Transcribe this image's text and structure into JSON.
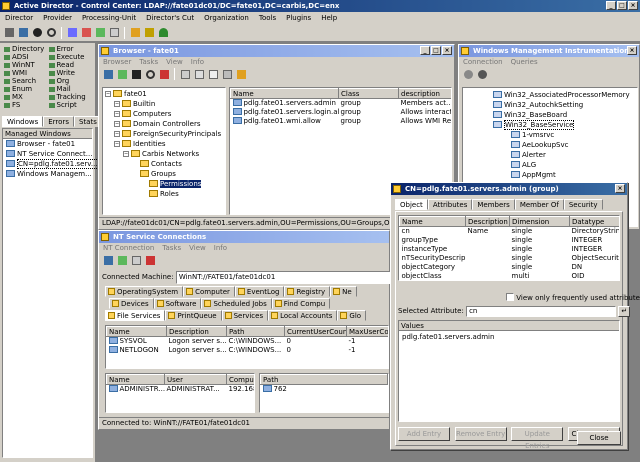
{
  "app": {
    "title": "Active Director - Control Center: LDAP://fate01dc01/DC=fate01,DC=carbis,DC=enx",
    "menu": [
      "Director",
      "Provider",
      "Processing-Unit",
      "Director's Cut",
      "Organization",
      "Tools",
      "Plugins",
      "Help"
    ]
  },
  "left_panel": {
    "buttons": [
      {
        "label": "Directory",
        "color": "#4a8a4a"
      },
      {
        "label": "Error",
        "color": "#4a8a4a"
      },
      {
        "label": "ADSI",
        "color": "#4a8a4a"
      },
      {
        "label": "Execute",
        "color": "#4a8a4a"
      },
      {
        "label": "WinNT",
        "color": "#4a8a4a"
      },
      {
        "label": "Read",
        "color": "#4a8a4a"
      },
      {
        "label": "WMI",
        "color": "#4a8a4a"
      },
      {
        "label": "Write",
        "color": "#4a8a4a"
      },
      {
        "label": "Search",
        "color": "#4a8a4a"
      },
      {
        "label": "Org",
        "color": "#4a8a4a"
      },
      {
        "label": "Enum",
        "color": "#4a8a4a"
      },
      {
        "label": "Mail",
        "color": "#4a8a4a"
      },
      {
        "label": "MX",
        "color": "#4a8a4a"
      },
      {
        "label": "Tracking",
        "color": "#4a8a4a"
      },
      {
        "label": "FS",
        "color": "#4a8a4a"
      },
      {
        "label": "Script",
        "color": "#4a8a4a"
      }
    ],
    "tabs": [
      "Windows",
      "Errors",
      "Stats"
    ],
    "managed_header": "Managed Windows",
    "managed_items": [
      "Browser - fate01",
      "NT Service Connect...",
      "CN=pdlg.fate01.serv...",
      "Windows Managem..."
    ]
  },
  "browser": {
    "title": "Browser - fate01",
    "menu": [
      "Browser",
      "Tasks",
      "View",
      "Info"
    ],
    "tree": [
      {
        "label": "fate01",
        "level": 0
      },
      {
        "label": "Builtin",
        "level": 1
      },
      {
        "label": "Computers",
        "level": 1
      },
      {
        "label": "Domain Controllers",
        "level": 1
      },
      {
        "label": "ForeignSecurityPrincipals",
        "level": 1
      },
      {
        "label": "Identities",
        "level": 1
      },
      {
        "label": "Carbis Networks",
        "level": 2
      },
      {
        "label": "Contacts",
        "level": 3
      },
      {
        "label": "Groups",
        "level": 3
      },
      {
        "label": "Permissions",
        "level": 4
      },
      {
        "label": "Roles",
        "level": 4
      }
    ],
    "columns": [
      "Name",
      "Class",
      "description"
    ],
    "rows": [
      [
        "pdlg.fate01.servers.admin",
        "group",
        "Members act..."
      ],
      [
        "pdlg.fate01.servers.login.allow",
        "group",
        "Allows interact..."
      ],
      [
        "pdlg.fate01.wmi.allow",
        "group",
        "Allows WMI Re..."
      ]
    ],
    "status": "LDAP://fate01dc01/CN=pdlg.fate01.servers.admin,OU=Permissions,OU=Groups,OU=Carbis Ne"
  },
  "wmi": {
    "title": "Windows Management Instrumentation",
    "menu": [
      "Connection",
      "Queries"
    ],
    "items": [
      "Win32_AssociatedProcessorMemory",
      "Win32_AutochkSetting",
      "Win32_BaseBoard",
      "Win32_BaseService",
      "1-vmsrvc",
      "AeLookupSvc",
      "Alerter",
      "ALG",
      "AppMgmt"
    ]
  },
  "nt": {
    "title": "NT Service Connections",
    "menu": [
      "NT Connection",
      "Tasks",
      "View",
      "Info"
    ],
    "machine_label": "Connected Machine:",
    "machine_value": "WinNT://FATE01/fate01dc01",
    "tabs_row1": [
      "OperatingSystem",
      "Computer",
      "EventLog",
      "Registry",
      "Ne"
    ],
    "tabs_row2": [
      "Devices",
      "Software",
      "Scheduled Jobs",
      "Find Compu"
    ],
    "tabs_row3": [
      "File Services",
      "PrintQueue",
      "Services",
      "Local Accounts",
      "Glo"
    ],
    "share_columns": [
      "Name",
      "Description",
      "Path",
      "CurrentUserCount",
      "MaxUserCou"
    ],
    "shares": [
      [
        "SYSVOL",
        "Logon server s...",
        "C:\\WINDOWS...",
        "0",
        "-1"
      ],
      [
        "NETLOGON",
        "Logon server s...",
        "C:\\WINDOWS...",
        "0",
        "-1"
      ]
    ],
    "session_columns": [
      "Name",
      "User",
      "Compute"
    ],
    "sessions": [
      [
        "ADMINISTR...",
        "ADMINISTRAT...",
        "192.168"
      ]
    ],
    "resource_columns": [
      "Path"
    ],
    "resources": [
      [
        "762"
      ]
    ],
    "status": "Connected to: WinNT://FATE01/fate01dc01"
  },
  "dialog": {
    "title": "CN=pdlg.fate01.servers.admin (group)",
    "tabs": [
      "Object",
      "Attributes",
      "Members",
      "Member Of",
      "Security"
    ],
    "columns": [
      "Name",
      "Description",
      "Dimension",
      "Datatype"
    ],
    "rows": [
      [
        "cn",
        "Name",
        "single",
        "DirectoryString"
      ],
      [
        "groupType",
        "",
        "single",
        "INTEGER"
      ],
      [
        "instanceType",
        "",
        "single",
        "INTEGER"
      ],
      [
        "nTSecurityDescrip...",
        "",
        "single",
        "ObjectSecurity"
      ],
      [
        "objectCategory",
        "",
        "single",
        "DN"
      ],
      [
        "objectClass",
        "",
        "multi",
        "OID"
      ]
    ],
    "checkbox_label": "View only frequently used attributes",
    "selected_label": "Selected Attribute:",
    "selected_value": "cn",
    "values_header": "Values",
    "values": [
      "pdlg.fate01.servers.admin"
    ],
    "buttons": [
      "Add Entry",
      "Remove Entry",
      "Update Entries",
      "Clear Entries"
    ],
    "close": "Close"
  }
}
